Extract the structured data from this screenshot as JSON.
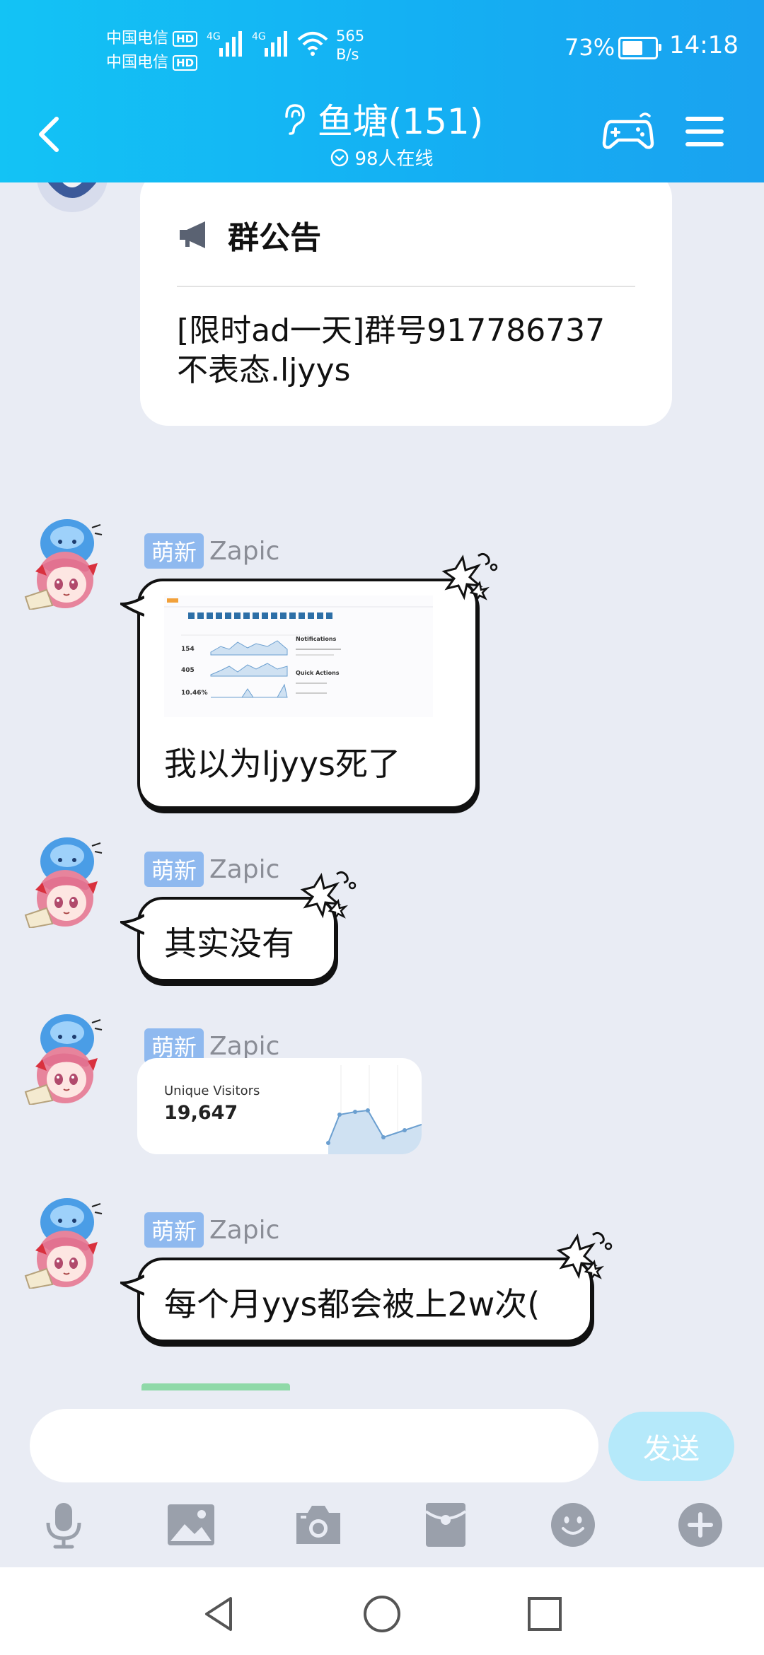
{
  "status_bar": {
    "carrier_1": "中国电信",
    "carrier_2": "中国电信",
    "hd_label": "HD",
    "network_type": "4G",
    "net_speed_value": "565",
    "net_speed_unit": "B/s",
    "battery_percent": "73%",
    "battery_level": 0.73,
    "time": "14:18"
  },
  "header": {
    "title": "鱼塘(151)",
    "online_count": "98人在线"
  },
  "announcement": {
    "title": "群公告",
    "line_1": "[限时ad一天]群号917786737",
    "line_2": "不表态.ljyys"
  },
  "messages": [
    {
      "badge": "萌新",
      "nickname": "Zapic",
      "text": "我以为ljyys死了"
    },
    {
      "badge": "萌新",
      "nickname": "Zapic",
      "text": "其实没有"
    },
    {
      "badge": "萌新",
      "nickname": "Zapic",
      "card_label": "Unique Visitors",
      "card_value": "19,647"
    },
    {
      "badge": "萌新",
      "nickname": "Zapic",
      "text": "每个月yys都会被上2w次("
    }
  ],
  "thumbnail": {
    "stat_1": "154",
    "stat_2": "405",
    "stat_3": "10.46%",
    "panel_1": "Notifications",
    "panel_2": "Quick Actions"
  },
  "input": {
    "value": "",
    "placeholder": "",
    "send_label": "发送"
  },
  "toolbar": {
    "icons": [
      "microphone-icon",
      "image-icon",
      "camera-icon",
      "red-packet-icon",
      "emoji-icon",
      "plus-icon"
    ]
  },
  "colors": {
    "header_gradient_start": "#13c3f5",
    "header_gradient_end": "#1aa2f0",
    "chat_background": "#e9ecf4",
    "badge": "#8fb9ef",
    "send_button": "#b5e9fa",
    "toolbar_icon": "#9aa0ab"
  }
}
